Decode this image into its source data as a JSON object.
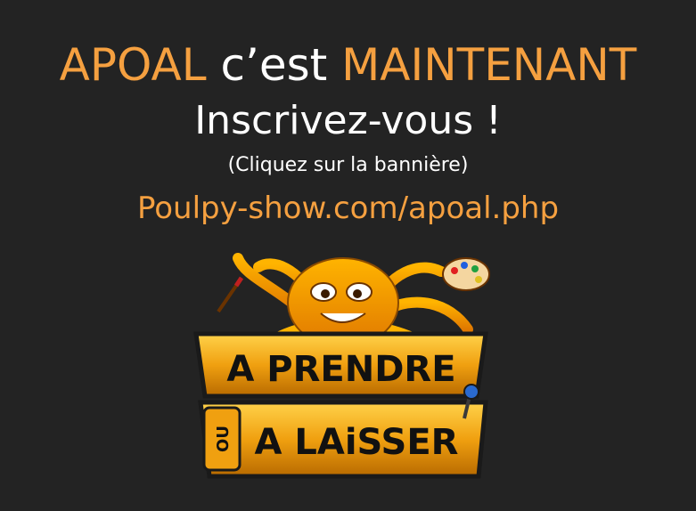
{
  "headline": {
    "part1": "APOAL",
    "part2": " c’est ",
    "part3": "MAINTENANT"
  },
  "subtitle": "Inscrivez-vous !",
  "hint": "(Cliquez sur la bannière)",
  "link_text": "Poulpy-show.com/apoal.php",
  "banner": {
    "line1": "A PRENDRE",
    "ou": "OU",
    "line2": "A LAiSSER"
  },
  "colors": {
    "background": "#232323",
    "accent": "#f5a040",
    "text": "#ffffff"
  }
}
